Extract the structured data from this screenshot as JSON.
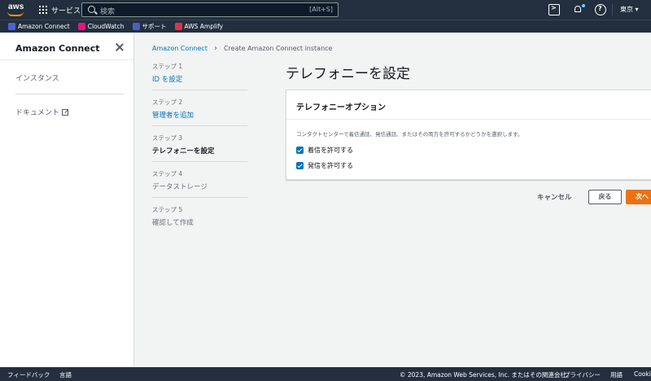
{
  "topnav": {
    "logo_text": "aws",
    "services_label": "サービス",
    "search": {
      "placeholder": "検索",
      "shortcut": "[Alt+S]"
    },
    "region": "東京 ▾",
    "icons": [
      "terminal-icon",
      "bell-icon",
      "help-icon"
    ],
    "notification_dot_color": "#66cfff"
  },
  "favorites": [
    {
      "label": "Amazon Connect",
      "icon": "amazon-connect-icon",
      "color": "#4b61d1"
    },
    {
      "label": "CloudWatch",
      "icon": "cloudwatch-icon",
      "color": "#e7157b"
    },
    {
      "label": "サポート",
      "icon": "support-icon",
      "color": "#4a5fc1"
    },
    {
      "label": "AWS Amplify",
      "icon": "amplify-icon",
      "color": "#dd344c"
    }
  ],
  "sidebar": {
    "title": "Amazon Connect",
    "items": [
      {
        "label": "インスタンス"
      },
      {
        "label": "ドキュメント"
      }
    ]
  },
  "breadcrumb": {
    "parent": "Amazon Connect",
    "current": "Create Amazon Connect instance"
  },
  "steps": [
    {
      "num": "ステップ 1",
      "label": "ID を設定",
      "state": "link"
    },
    {
      "num": "ステップ 2",
      "label": "管理者を追加",
      "state": "link"
    },
    {
      "num": "ステップ 3",
      "label": "テレフォニーを設定",
      "state": "active"
    },
    {
      "num": "ステップ 4",
      "label": "データストレージ",
      "state": "muted"
    },
    {
      "num": "ステップ 5",
      "label": "確認して作成",
      "state": "muted"
    }
  ],
  "main": {
    "title": "テレフォニーを設定",
    "panel": {
      "title": "テレフォニーオプション",
      "description": "コンタクトセンターで着信通話、発信通話、またはその両方を許可するかどうかを選択します。",
      "options": [
        {
          "label": "着信を許可する",
          "checked": true
        },
        {
          "label": "発信を許可する",
          "checked": true
        }
      ]
    },
    "buttons": {
      "cancel": "キャンセル",
      "back": "戻る",
      "next": "次へ"
    }
  },
  "footer": {
    "feedback": "フィードバック",
    "language": "言語",
    "copyright": "© 2023, Amazon Web Services, Inc. またはその関連会社。",
    "privacy": "プライバシー",
    "terms": "用語",
    "cookie": "Cookie"
  },
  "colors": {
    "nav_bg": "#232f3e",
    "link": "#0073bb",
    "primary_button": "#ec7211",
    "brand_orange": "#ff9900"
  }
}
